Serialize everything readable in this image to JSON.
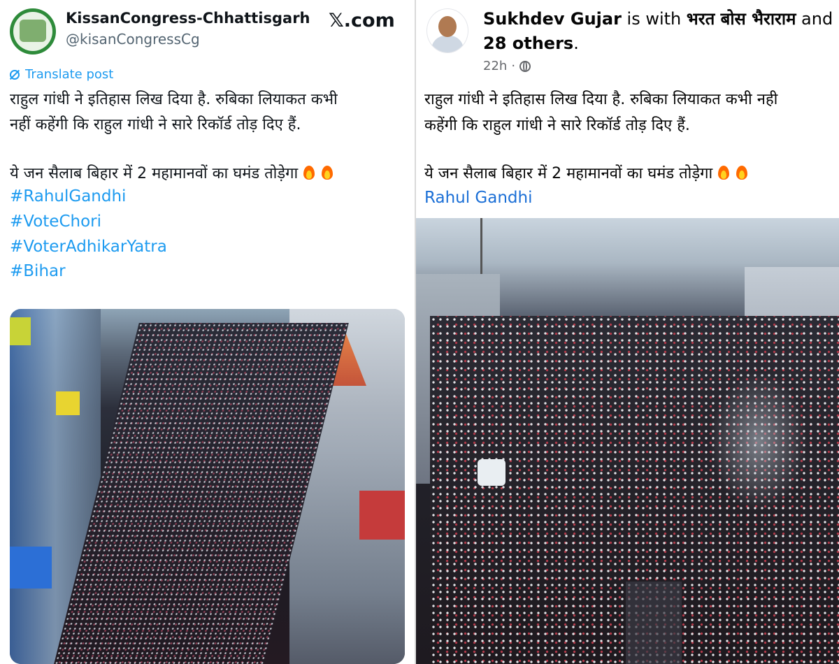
{
  "left_post": {
    "account_name": "KissanCongress-Chhattisgarh",
    "handle": "@kisanCongressCg",
    "platform_label": "𝕏.com",
    "translate_label": "Translate post",
    "text_line1": "राहुल गांधी ने इतिहास लिख दिया है. रुबिका लियाकत कभी",
    "text_line2": "नहीं कहेंगी कि राहुल गांधी ने सारे रिकॉर्ड तोड़ दिए हैं.",
    "text_line3": "ये जन सैलाब बिहार में 2 महामानवों का घमंड तोड़ेगा",
    "hashtags": [
      "#RahulGandhi",
      "#VoteChori",
      "#VoterAdhikarYatra",
      "#Bihar"
    ]
  },
  "right_post": {
    "author": "Sukhdev Gujar",
    "is_with": " is with ",
    "tagged": "भरत बोस भैराराम",
    "and_text": " and",
    "others": "28 others",
    "period": ".",
    "time": "22h",
    "dot": "·",
    "text_line1": "राहुल गांधी ने इतिहास लिख दिया है. रुबिका लियाकत कभी नही",
    "text_line2": "कहेंगी कि राहुल गांधी ने सारे रिकॉर्ड तोड़ दिए हैं.",
    "text_line3": "ये जन सैलाब बिहार में 2 महामानवों का घमंड तोड़ेगा",
    "link_text": "Rahul Gandhi"
  },
  "icons": {
    "fire": "fire-emoji",
    "globe": "globe-icon",
    "translate": "translate-icon"
  }
}
